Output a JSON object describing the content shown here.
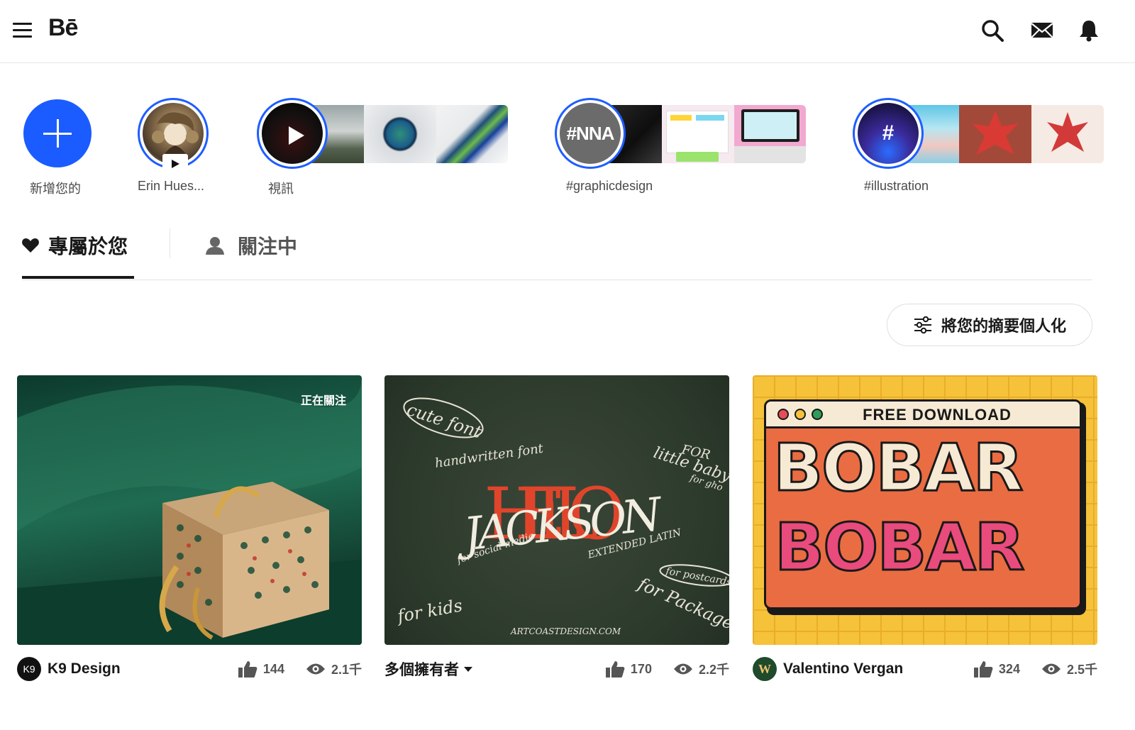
{
  "header": {
    "logo": "Bē",
    "icons": [
      "menu-icon",
      "search-icon",
      "mail-icon",
      "bell-icon"
    ]
  },
  "stories": [
    {
      "label": "新增您的"
    },
    {
      "label": "Erin Hues..."
    },
    {
      "label": "視訊"
    },
    {
      "label": "#graphicdesign",
      "avatar_text": "#"
    },
    {
      "label": "#illustration",
      "avatar_text": "#"
    }
  ],
  "tabs": {
    "for_you": "專屬於您",
    "following": "關注中"
  },
  "personalize_label": "將您的摘要個人化",
  "cards": [
    {
      "owner": "K9 Design",
      "avatar_text": "K9",
      "likes": "144",
      "views": "2.1千",
      "badge": "正在關注"
    },
    {
      "owner": "多個擁有者",
      "likes": "170",
      "views": "2.2千"
    },
    {
      "owner": "Valentino Vergan",
      "avatar_text": "W",
      "likes": "324",
      "views": "2.5千"
    }
  ],
  "card2_art": {
    "cute": "cute font",
    "hand": "handwritten font",
    "for": "FOR",
    "little": "little baby",
    "for_small": "for gho",
    "hello": "HELLO",
    "jackson": "JACKSON",
    "social": "for social media",
    "extended": "EXTENDED LATIN",
    "postcards": "for postcards",
    "package": "for Package",
    "kids": "for kids",
    "url": "ARTCOASTDESIGN.COM"
  },
  "card3_art": {
    "banner": "FREE DOWNLOAD",
    "word1": "BOBAR",
    "word2": "BOBAR"
  },
  "story3_text": "#NNA",
  "colors": {
    "accent": "#1a5cff",
    "text": "#191919"
  }
}
